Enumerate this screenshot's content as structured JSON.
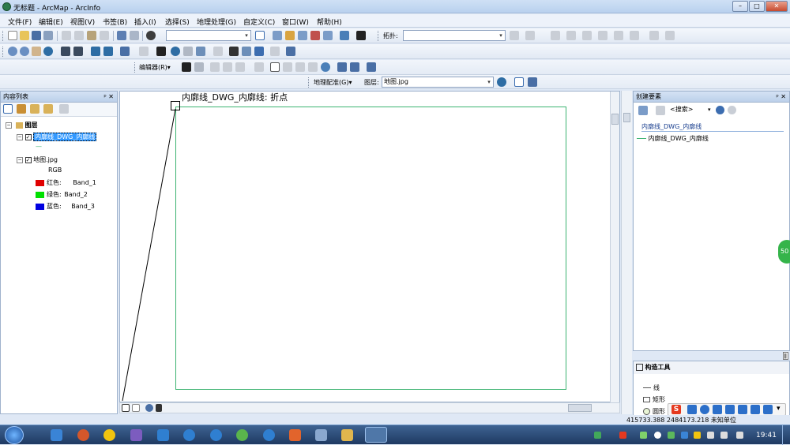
{
  "window": {
    "title": "无标题 - ArcMap - ArcInfo",
    "min_label": "–",
    "max_label": "□",
    "close_label": "✕"
  },
  "menu": [
    "文件(F)",
    "编辑(E)",
    "视图(V)",
    "书签(B)",
    "插入(I)",
    "选择(S)",
    "地理处理(G)",
    "自定义(C)",
    "窗口(W)",
    "帮助(H)"
  ],
  "toolbar": {
    "topology_label": "拓扑:",
    "editor_label": "编辑器(R)▾",
    "georef_label": "地理配准(G)▾",
    "layer_label": "图层:",
    "layer_value": "地图.jpg"
  },
  "toc": {
    "title": "内容列表",
    "pin": "ᵖ ✕",
    "root": "图层",
    "layer1": "内廓线_DWG_内廓线",
    "layer1_symbol": "—",
    "layer2": "地图.jpg",
    "rgb": "RGB",
    "bands": [
      {
        "label": "红色:",
        "band": "Band_1",
        "color": "#e00000"
      },
      {
        "label": "绿色:",
        "band": "Band_2",
        "color": "#00e000"
      },
      {
        "label": "蓝色:",
        "band": "Band_3",
        "color": "#0000e0"
      }
    ]
  },
  "map": {
    "snap_tip": "内廓线_DWG_内廓线: 折点",
    "frame_color": "#3cb371"
  },
  "create_features": {
    "title": "创建要素",
    "pin": "ᵖ ✕",
    "search_placeholder": "<搜索>",
    "group": "内廓线_DWG_内廓线",
    "template": "内廓线_DWG_内廓线"
  },
  "construct": {
    "title": "构造工具",
    "items": [
      "线",
      "矩形",
      "圆形"
    ]
  },
  "status": {
    "coords": "415733.388  2484173.218 未知单位"
  },
  "taskbar": {
    "clock": "19:41",
    "badge": "50"
  }
}
